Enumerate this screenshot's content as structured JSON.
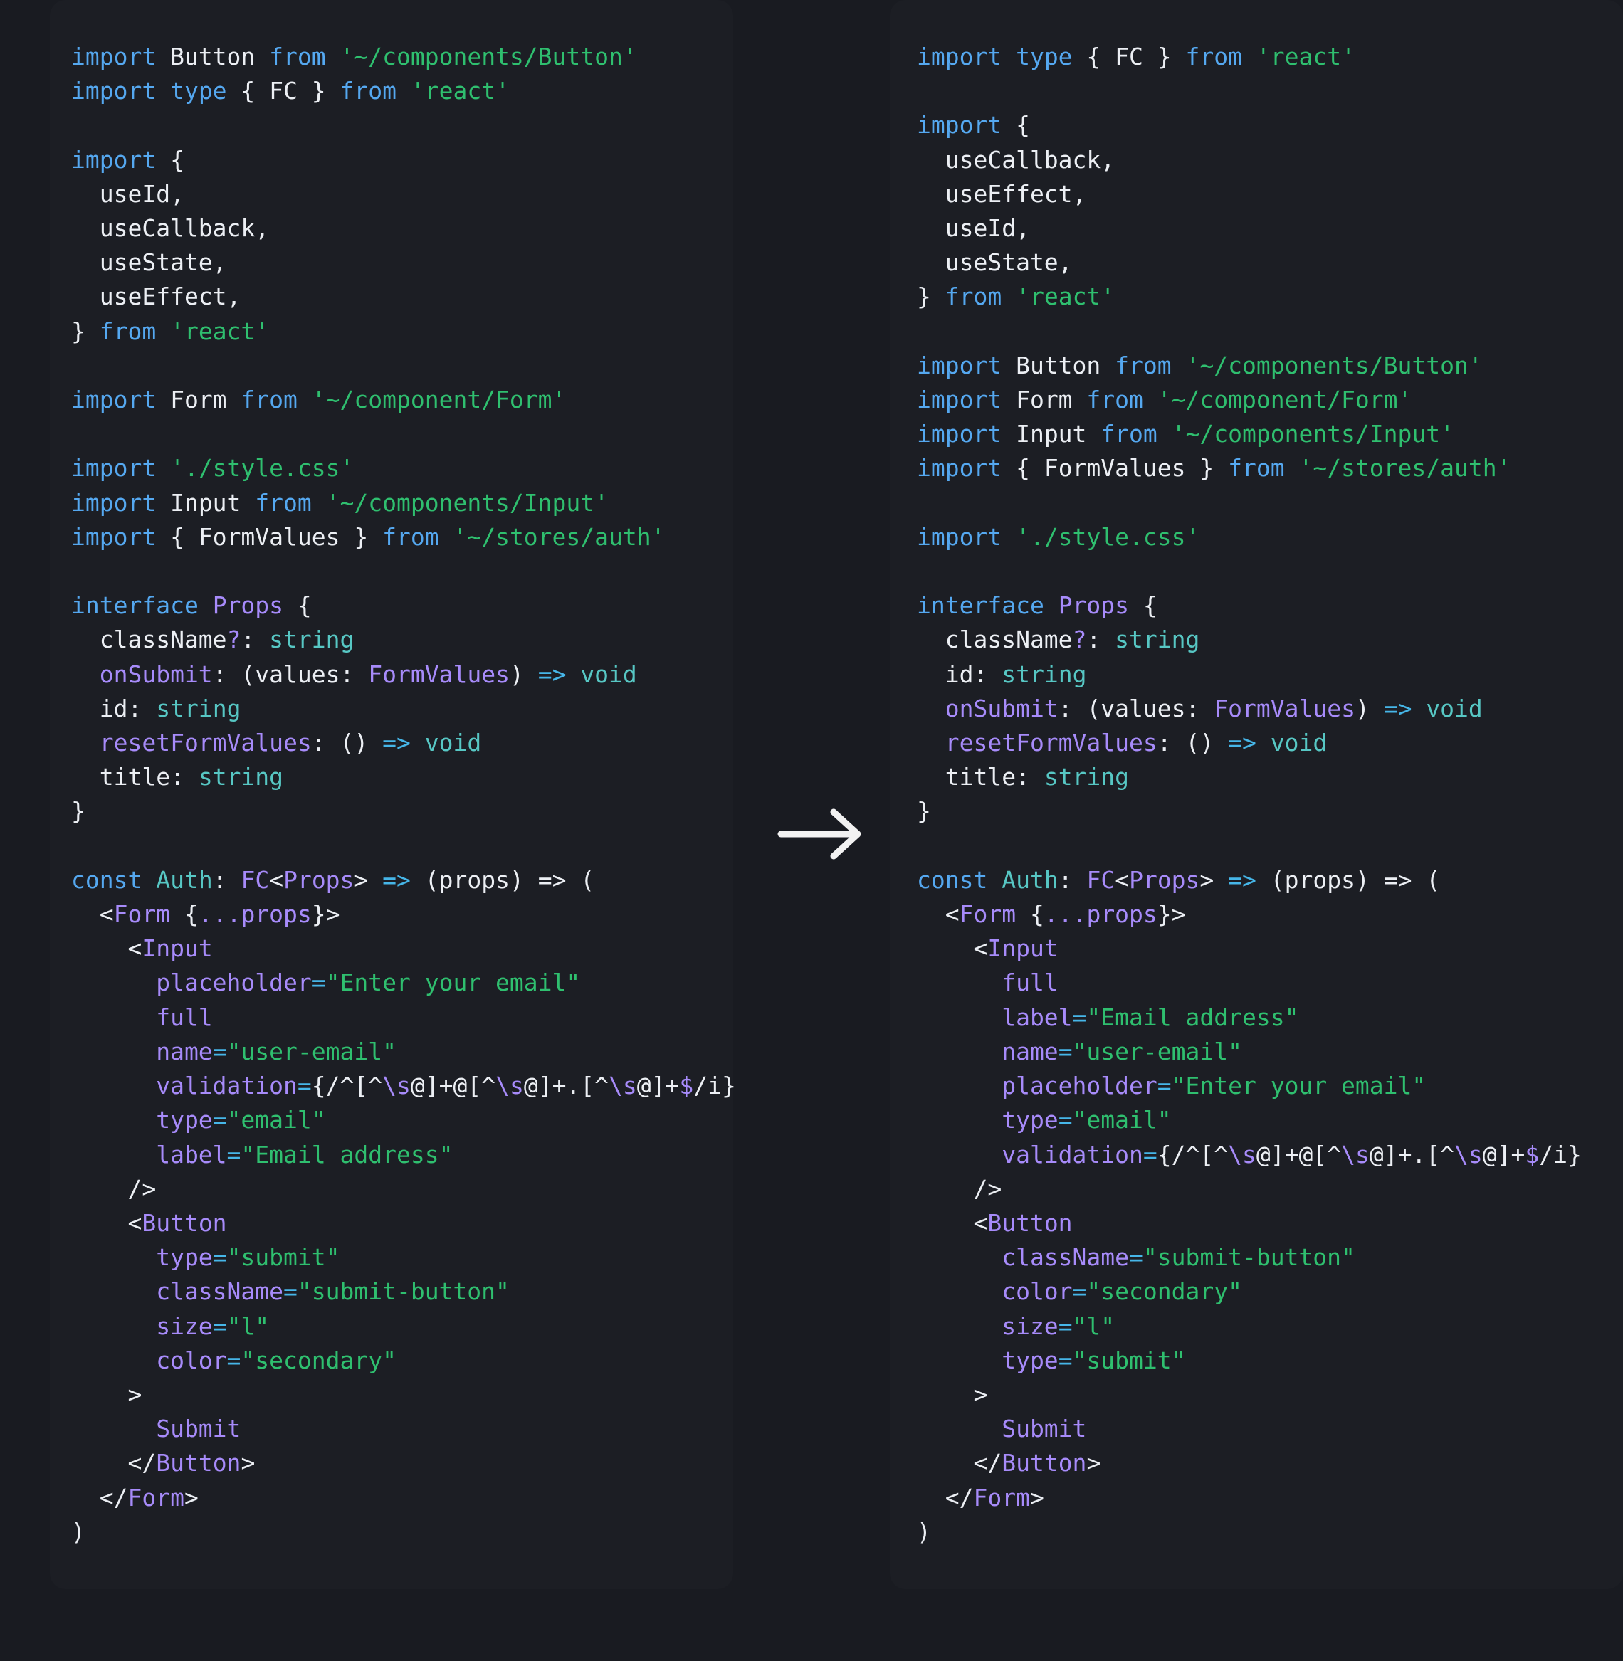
{
  "meta": {
    "view": "code-diff-comparison",
    "background": "#191b21",
    "panel_background": "#1c1e24"
  },
  "arrow": {
    "icon": "arrow-right-icon",
    "color": "#f0f0f0",
    "direction": "right"
  },
  "colors": {
    "keyword": "#55a8f0",
    "string": "#2fbf6f",
    "plain": "#eceff4",
    "type": "#a78bfa",
    "builtin_type": "#57c7c4",
    "operator": "#46b6e8"
  },
  "left_panel": {
    "title": "before",
    "language": "tsx",
    "lines": [
      [
        {
          "t": "import ",
          "c": "kw"
        },
        {
          "t": "Button",
          "c": "pln"
        },
        {
          "t": " from ",
          "c": "kw"
        },
        {
          "t": "'~/components/Button'",
          "c": "str"
        }
      ],
      [
        {
          "t": "import ",
          "c": "kw"
        },
        {
          "t": "type",
          "c": "kw"
        },
        {
          "t": " { ",
          "c": "pln"
        },
        {
          "t": "FC",
          "c": "pln"
        },
        {
          "t": " } ",
          "c": "pln"
        },
        {
          "t": "from ",
          "c": "kw"
        },
        {
          "t": "'react'",
          "c": "str"
        }
      ],
      [],
      [
        {
          "t": "import ",
          "c": "kw"
        },
        {
          "t": "{",
          "c": "pln"
        }
      ],
      [
        {
          "t": "  useId,",
          "c": "pln"
        }
      ],
      [
        {
          "t": "  useCallback,",
          "c": "pln"
        }
      ],
      [
        {
          "t": "  useState,",
          "c": "pln"
        }
      ],
      [
        {
          "t": "  useEffect,",
          "c": "pln"
        }
      ],
      [
        {
          "t": "} ",
          "c": "pln"
        },
        {
          "t": "from ",
          "c": "kw"
        },
        {
          "t": "'react'",
          "c": "str"
        }
      ],
      [],
      [
        {
          "t": "import ",
          "c": "kw"
        },
        {
          "t": "Form",
          "c": "pln"
        },
        {
          "t": " from ",
          "c": "kw"
        },
        {
          "t": "'~/component/Form'",
          "c": "str"
        }
      ],
      [],
      [
        {
          "t": "import ",
          "c": "kw"
        },
        {
          "t": "'./style.css'",
          "c": "str"
        }
      ],
      [
        {
          "t": "import ",
          "c": "kw"
        },
        {
          "t": "Input",
          "c": "pln"
        },
        {
          "t": " from ",
          "c": "kw"
        },
        {
          "t": "'~/components/Input'",
          "c": "str"
        }
      ],
      [
        {
          "t": "import ",
          "c": "kw"
        },
        {
          "t": "{ ",
          "c": "pln"
        },
        {
          "t": "FormValues",
          "c": "pln"
        },
        {
          "t": " } ",
          "c": "pln"
        },
        {
          "t": "from ",
          "c": "kw"
        },
        {
          "t": "'~/stores/auth'",
          "c": "str"
        }
      ],
      [],
      [
        {
          "t": "interface ",
          "c": "kw"
        },
        {
          "t": "Props",
          "c": "typ"
        },
        {
          "t": " {",
          "c": "pln"
        }
      ],
      [
        {
          "t": "  className",
          "c": "pln"
        },
        {
          "t": "?",
          "c": "typ"
        },
        {
          "t": ": ",
          "c": "pln"
        },
        {
          "t": "string",
          "c": "cya"
        }
      ],
      [
        {
          "t": "  onSubmit",
          "c": "typ"
        },
        {
          "t": ": ",
          "c": "pln"
        },
        {
          "t": "(values",
          "c": "pln"
        },
        {
          "t": ": ",
          "c": "pln"
        },
        {
          "t": "FormValues",
          "c": "typ"
        },
        {
          "t": ") ",
          "c": "pln"
        },
        {
          "t": "=> ",
          "c": "op"
        },
        {
          "t": "void",
          "c": "cya"
        }
      ],
      [
        {
          "t": "  id",
          "c": "pln"
        },
        {
          "t": ": ",
          "c": "pln"
        },
        {
          "t": "string",
          "c": "cya"
        }
      ],
      [
        {
          "t": "  resetFormValues",
          "c": "typ"
        },
        {
          "t": ": ",
          "c": "pln"
        },
        {
          "t": "() ",
          "c": "pln"
        },
        {
          "t": "=> ",
          "c": "op"
        },
        {
          "t": "void",
          "c": "cya"
        }
      ],
      [
        {
          "t": "  title",
          "c": "pln"
        },
        {
          "t": ": ",
          "c": "pln"
        },
        {
          "t": "string",
          "c": "cya"
        }
      ],
      [
        {
          "t": "}",
          "c": "pln"
        }
      ],
      [],
      [
        {
          "t": "const ",
          "c": "kw"
        },
        {
          "t": "Auth",
          "c": "cya"
        },
        {
          "t": ": ",
          "c": "pln"
        },
        {
          "t": "FC",
          "c": "typ"
        },
        {
          "t": "<",
          "c": "pln"
        },
        {
          "t": "Props",
          "c": "typ"
        },
        {
          "t": "> ",
          "c": "pln"
        },
        {
          "t": "=> ",
          "c": "op"
        },
        {
          "t": "(props) => (",
          "c": "pln"
        }
      ],
      [
        {
          "t": "  <",
          "c": "pln"
        },
        {
          "t": "Form",
          "c": "typ"
        },
        {
          "t": " {",
          "c": "pln"
        },
        {
          "t": "...props",
          "c": "typ"
        },
        {
          "t": "}>",
          "c": "pln"
        }
      ],
      [
        {
          "t": "    <",
          "c": "pln"
        },
        {
          "t": "Input",
          "c": "typ"
        }
      ],
      [
        {
          "t": "      placeholder",
          "c": "typ"
        },
        {
          "t": "=",
          "c": "op"
        },
        {
          "t": "\"Enter your email\"",
          "c": "str"
        }
      ],
      [
        {
          "t": "      full",
          "c": "typ"
        }
      ],
      [
        {
          "t": "      name",
          "c": "typ"
        },
        {
          "t": "=",
          "c": "op"
        },
        {
          "t": "\"user-email\"",
          "c": "str"
        }
      ],
      [
        {
          "t": "      validation",
          "c": "typ"
        },
        {
          "t": "=",
          "c": "op"
        },
        {
          "t": "{/^[^",
          "c": "pln"
        },
        {
          "t": "\\s",
          "c": "typ"
        },
        {
          "t": "@]+@[^",
          "c": "pln"
        },
        {
          "t": "\\s",
          "c": "typ"
        },
        {
          "t": "@]+.[^",
          "c": "pln"
        },
        {
          "t": "\\s",
          "c": "typ"
        },
        {
          "t": "@]+",
          "c": "pln"
        },
        {
          "t": "$",
          "c": "typ"
        },
        {
          "t": "/i}",
          "c": "pln"
        }
      ],
      [
        {
          "t": "      type",
          "c": "typ"
        },
        {
          "t": "=",
          "c": "op"
        },
        {
          "t": "\"email\"",
          "c": "str"
        }
      ],
      [
        {
          "t": "      label",
          "c": "typ"
        },
        {
          "t": "=",
          "c": "op"
        },
        {
          "t": "\"Email address\"",
          "c": "str"
        }
      ],
      [
        {
          "t": "    />",
          "c": "pln"
        }
      ],
      [
        {
          "t": "    <",
          "c": "pln"
        },
        {
          "t": "Button",
          "c": "typ"
        }
      ],
      [
        {
          "t": "      type",
          "c": "typ"
        },
        {
          "t": "=",
          "c": "op"
        },
        {
          "t": "\"submit\"",
          "c": "str"
        }
      ],
      [
        {
          "t": "      className",
          "c": "typ"
        },
        {
          "t": "=",
          "c": "op"
        },
        {
          "t": "\"submit-button\"",
          "c": "str"
        }
      ],
      [
        {
          "t": "      size",
          "c": "typ"
        },
        {
          "t": "=",
          "c": "op"
        },
        {
          "t": "\"l\"",
          "c": "str"
        }
      ],
      [
        {
          "t": "      color",
          "c": "typ"
        },
        {
          "t": "=",
          "c": "op"
        },
        {
          "t": "\"secondary\"",
          "c": "str"
        }
      ],
      [
        {
          "t": "    >",
          "c": "pln"
        }
      ],
      [
        {
          "t": "      Submit",
          "c": "typ"
        }
      ],
      [
        {
          "t": "    </",
          "c": "pln"
        },
        {
          "t": "Button",
          "c": "typ"
        },
        {
          "t": ">",
          "c": "pln"
        }
      ],
      [
        {
          "t": "  </",
          "c": "pln"
        },
        {
          "t": "Form",
          "c": "typ"
        },
        {
          "t": ">",
          "c": "pln"
        }
      ],
      [
        {
          "t": ")",
          "c": "pln"
        }
      ]
    ]
  },
  "right_panel": {
    "title": "after",
    "language": "tsx",
    "lines": [
      [
        {
          "t": "import ",
          "c": "kw"
        },
        {
          "t": "type",
          "c": "kw"
        },
        {
          "t": " { ",
          "c": "pln"
        },
        {
          "t": "FC",
          "c": "pln"
        },
        {
          "t": " } ",
          "c": "pln"
        },
        {
          "t": "from ",
          "c": "kw"
        },
        {
          "t": "'react'",
          "c": "str"
        }
      ],
      [],
      [
        {
          "t": "import ",
          "c": "kw"
        },
        {
          "t": "{",
          "c": "pln"
        }
      ],
      [
        {
          "t": "  useCallback,",
          "c": "pln"
        }
      ],
      [
        {
          "t": "  useEffect,",
          "c": "pln"
        }
      ],
      [
        {
          "t": "  useId,",
          "c": "pln"
        }
      ],
      [
        {
          "t": "  useState,",
          "c": "pln"
        }
      ],
      [
        {
          "t": "} ",
          "c": "pln"
        },
        {
          "t": "from ",
          "c": "kw"
        },
        {
          "t": "'react'",
          "c": "str"
        }
      ],
      [],
      [
        {
          "t": "import ",
          "c": "kw"
        },
        {
          "t": "Button",
          "c": "pln"
        },
        {
          "t": " from ",
          "c": "kw"
        },
        {
          "t": "'~/components/Button'",
          "c": "str"
        }
      ],
      [
        {
          "t": "import ",
          "c": "kw"
        },
        {
          "t": "Form",
          "c": "pln"
        },
        {
          "t": " from ",
          "c": "kw"
        },
        {
          "t": "'~/component/Form'",
          "c": "str"
        }
      ],
      [
        {
          "t": "import ",
          "c": "kw"
        },
        {
          "t": "Input",
          "c": "pln"
        },
        {
          "t": " from ",
          "c": "kw"
        },
        {
          "t": "'~/components/Input'",
          "c": "str"
        }
      ],
      [
        {
          "t": "import ",
          "c": "kw"
        },
        {
          "t": "{ ",
          "c": "pln"
        },
        {
          "t": "FormValues",
          "c": "pln"
        },
        {
          "t": " } ",
          "c": "pln"
        },
        {
          "t": "from ",
          "c": "kw"
        },
        {
          "t": "'~/stores/auth'",
          "c": "str"
        }
      ],
      [],
      [
        {
          "t": "import ",
          "c": "kw"
        },
        {
          "t": "'./style.css'",
          "c": "str"
        }
      ],
      [],
      [
        {
          "t": "interface ",
          "c": "kw"
        },
        {
          "t": "Props",
          "c": "typ"
        },
        {
          "t": " {",
          "c": "pln"
        }
      ],
      [
        {
          "t": "  className",
          "c": "pln"
        },
        {
          "t": "?",
          "c": "typ"
        },
        {
          "t": ": ",
          "c": "pln"
        },
        {
          "t": "string",
          "c": "cya"
        }
      ],
      [
        {
          "t": "  id",
          "c": "pln"
        },
        {
          "t": ": ",
          "c": "pln"
        },
        {
          "t": "string",
          "c": "cya"
        }
      ],
      [
        {
          "t": "  onSubmit",
          "c": "typ"
        },
        {
          "t": ": ",
          "c": "pln"
        },
        {
          "t": "(values",
          "c": "pln"
        },
        {
          "t": ": ",
          "c": "pln"
        },
        {
          "t": "FormValues",
          "c": "typ"
        },
        {
          "t": ") ",
          "c": "pln"
        },
        {
          "t": "=> ",
          "c": "op"
        },
        {
          "t": "void",
          "c": "cya"
        }
      ],
      [
        {
          "t": "  resetFormValues",
          "c": "typ"
        },
        {
          "t": ": ",
          "c": "pln"
        },
        {
          "t": "() ",
          "c": "pln"
        },
        {
          "t": "=> ",
          "c": "op"
        },
        {
          "t": "void",
          "c": "cya"
        }
      ],
      [
        {
          "t": "  title",
          "c": "pln"
        },
        {
          "t": ": ",
          "c": "pln"
        },
        {
          "t": "string",
          "c": "cya"
        }
      ],
      [
        {
          "t": "}",
          "c": "pln"
        }
      ],
      [],
      [
        {
          "t": "const ",
          "c": "kw"
        },
        {
          "t": "Auth",
          "c": "cya"
        },
        {
          "t": ": ",
          "c": "pln"
        },
        {
          "t": "FC",
          "c": "typ"
        },
        {
          "t": "<",
          "c": "pln"
        },
        {
          "t": "Props",
          "c": "typ"
        },
        {
          "t": "> ",
          "c": "pln"
        },
        {
          "t": "=> ",
          "c": "op"
        },
        {
          "t": "(props) => (",
          "c": "pln"
        }
      ],
      [
        {
          "t": "  <",
          "c": "pln"
        },
        {
          "t": "Form",
          "c": "typ"
        },
        {
          "t": " {",
          "c": "pln"
        },
        {
          "t": "...props",
          "c": "typ"
        },
        {
          "t": "}>",
          "c": "pln"
        }
      ],
      [
        {
          "t": "    <",
          "c": "pln"
        },
        {
          "t": "Input",
          "c": "typ"
        }
      ],
      [
        {
          "t": "      full",
          "c": "typ"
        }
      ],
      [
        {
          "t": "      label",
          "c": "typ"
        },
        {
          "t": "=",
          "c": "op"
        },
        {
          "t": "\"Email address\"",
          "c": "str"
        }
      ],
      [
        {
          "t": "      name",
          "c": "typ"
        },
        {
          "t": "=",
          "c": "op"
        },
        {
          "t": "\"user-email\"",
          "c": "str"
        }
      ],
      [
        {
          "t": "      placeholder",
          "c": "typ"
        },
        {
          "t": "=",
          "c": "op"
        },
        {
          "t": "\"Enter your email\"",
          "c": "str"
        }
      ],
      [
        {
          "t": "      type",
          "c": "typ"
        },
        {
          "t": "=",
          "c": "op"
        },
        {
          "t": "\"email\"",
          "c": "str"
        }
      ],
      [
        {
          "t": "      validation",
          "c": "typ"
        },
        {
          "t": "=",
          "c": "op"
        },
        {
          "t": "{/^[^",
          "c": "pln"
        },
        {
          "t": "\\s",
          "c": "typ"
        },
        {
          "t": "@]+@[^",
          "c": "pln"
        },
        {
          "t": "\\s",
          "c": "typ"
        },
        {
          "t": "@]+.[^",
          "c": "pln"
        },
        {
          "t": "\\s",
          "c": "typ"
        },
        {
          "t": "@]+",
          "c": "pln"
        },
        {
          "t": "$",
          "c": "typ"
        },
        {
          "t": "/i}",
          "c": "pln"
        }
      ],
      [
        {
          "t": "    />",
          "c": "pln"
        }
      ],
      [
        {
          "t": "    <",
          "c": "pln"
        },
        {
          "t": "Button",
          "c": "typ"
        }
      ],
      [
        {
          "t": "      className",
          "c": "typ"
        },
        {
          "t": "=",
          "c": "op"
        },
        {
          "t": "\"submit-button\"",
          "c": "str"
        }
      ],
      [
        {
          "t": "      color",
          "c": "typ"
        },
        {
          "t": "=",
          "c": "op"
        },
        {
          "t": "\"secondary\"",
          "c": "str"
        }
      ],
      [
        {
          "t": "      size",
          "c": "typ"
        },
        {
          "t": "=",
          "c": "op"
        },
        {
          "t": "\"l\"",
          "c": "str"
        }
      ],
      [
        {
          "t": "      type",
          "c": "typ"
        },
        {
          "t": "=",
          "c": "op"
        },
        {
          "t": "\"submit\"",
          "c": "str"
        }
      ],
      [
        {
          "t": "    >",
          "c": "pln"
        }
      ],
      [
        {
          "t": "      Submit",
          "c": "typ"
        }
      ],
      [
        {
          "t": "    </",
          "c": "pln"
        },
        {
          "t": "Button",
          "c": "typ"
        },
        {
          "t": ">",
          "c": "pln"
        }
      ],
      [
        {
          "t": "  </",
          "c": "pln"
        },
        {
          "t": "Form",
          "c": "typ"
        },
        {
          "t": ">",
          "c": "pln"
        }
      ],
      [
        {
          "t": ")",
          "c": "pln"
        }
      ]
    ]
  }
}
